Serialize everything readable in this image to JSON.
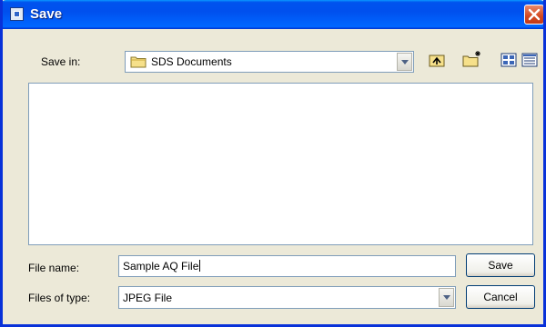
{
  "window": {
    "title": "Save"
  },
  "save_in": {
    "label": "Save in:",
    "value": "SDS Documents",
    "icon": "folder-icon"
  },
  "toolbar": {
    "up_one_level_icon": "up-folder-icon",
    "new_folder_icon": "new-folder-icon",
    "view_menu_icon": "view-menu-icon",
    "details_icon": "details-view-icon"
  },
  "file_name": {
    "label": "File name:",
    "value": "Sample AQ File"
  },
  "file_type": {
    "label": "Files of type:",
    "value": "JPEG File"
  },
  "buttons": {
    "save_label": "Save",
    "cancel_label": "Cancel"
  },
  "colors": {
    "titlebar": "#0053ee",
    "dialog_bg": "#ece9d8",
    "border": "#7f9db9",
    "close": "#d3481f"
  }
}
